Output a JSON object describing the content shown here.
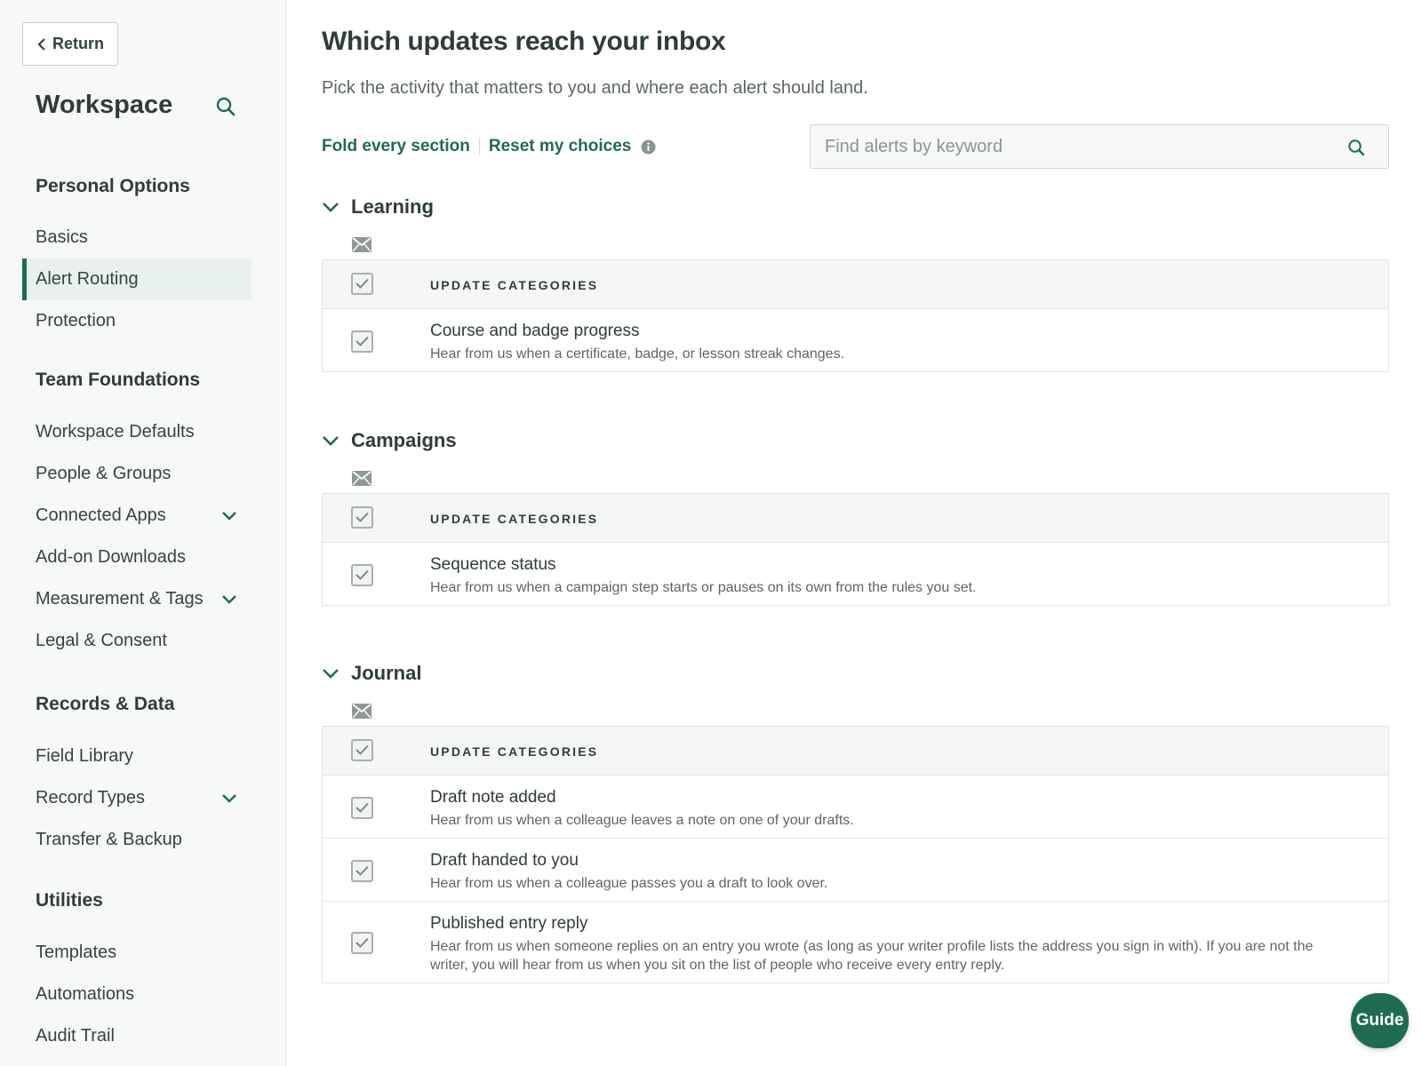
{
  "sidebar": {
    "return_label": "Return",
    "title": "Workspace",
    "sections": [
      {
        "heading": "Personal Options",
        "items": [
          {
            "label": "Basics"
          },
          {
            "label": "Alert Routing"
          },
          {
            "label": "Protection"
          }
        ]
      },
      {
        "heading": "Team Foundations",
        "items": [
          {
            "label": "Workspace Defaults"
          },
          {
            "label": "People & Groups"
          },
          {
            "label": "Connected Apps"
          },
          {
            "label": "Add-on Downloads"
          },
          {
            "label": "Measurement & Tags"
          },
          {
            "label": "Legal & Consent"
          }
        ]
      },
      {
        "heading": "Records & Data",
        "items": [
          {
            "label": "Field Library"
          },
          {
            "label": "Record Types"
          },
          {
            "label": "Transfer & Backup"
          }
        ]
      },
      {
        "heading": "Utilities",
        "items": [
          {
            "label": "Templates"
          },
          {
            "label": "Automations"
          },
          {
            "label": "Audit Trail"
          }
        ]
      }
    ]
  },
  "main": {
    "title": "Which updates reach your inbox",
    "subtitle": "Pick the activity that matters to you and where each alert should land.",
    "fold_all_label": "Fold every section",
    "reset_label": "Reset my choices",
    "search_placeholder": "Find alerts by keyword",
    "header_label": "UPDATE CATEGORIES",
    "sections": [
      {
        "title": "Learning",
        "items": [
          {
            "title": "Course and badge progress",
            "desc": "Hear from us when a certificate, badge, or lesson streak changes."
          }
        ]
      },
      {
        "title": "Campaigns",
        "items": [
          {
            "title": "Sequence status",
            "desc": "Hear from us when a campaign step starts or pauses on its own from the rules you set."
          }
        ]
      },
      {
        "title": "Journal",
        "items": [
          {
            "title": "Draft note added",
            "desc": "Hear from us when a colleague leaves a note on one of your drafts."
          },
          {
            "title": "Draft handed to you",
            "desc": "Hear from us when a colleague passes you a draft to look over."
          },
          {
            "title": "Published entry reply",
            "desc": "Hear from us when someone replies on an entry you wrote (as long as your writer profile lists the address you sign in with). If you are not the writer, you will hear from us when you sit on the list of people who receive every entry reply."
          }
        ]
      }
    ]
  },
  "guide_label": "Guide",
  "colors": {
    "accent": "#1f6b52",
    "active_bg": "#e9f1ee",
    "sidebar_bg": "#f7f8f8"
  }
}
